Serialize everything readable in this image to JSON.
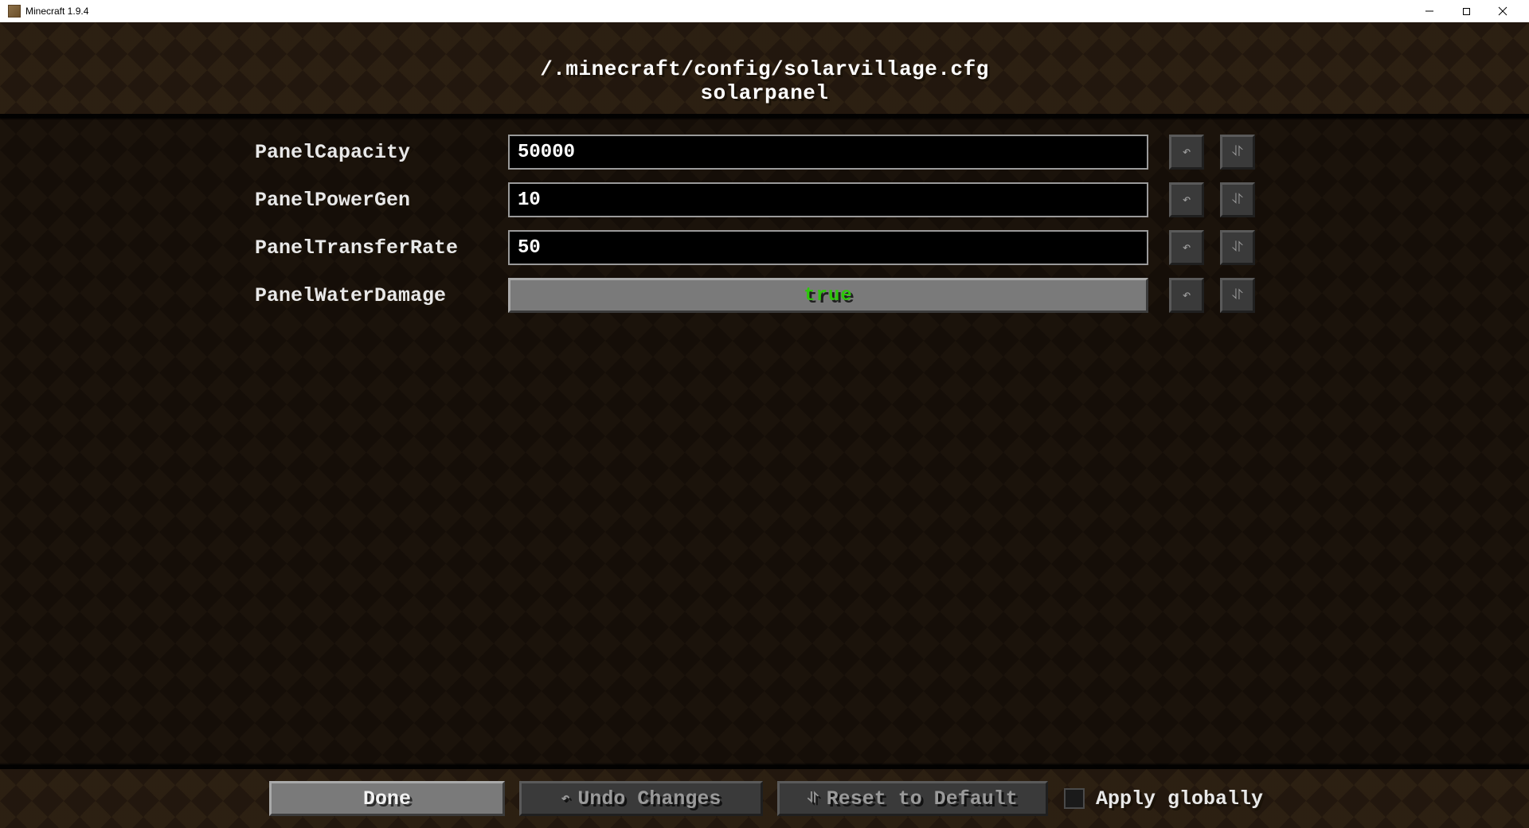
{
  "window": {
    "title": "Minecraft 1.9.4"
  },
  "header": {
    "path": "/.minecraft/config/solarvillage.cfg",
    "section": "solarpanel"
  },
  "config_rows": [
    {
      "key": "PanelCapacity",
      "type": "text",
      "value": "50000"
    },
    {
      "key": "PanelPowerGen",
      "type": "text",
      "value": "10"
    },
    {
      "key": "PanelTransferRate",
      "type": "text",
      "value": "50"
    },
    {
      "key": "PanelWaterDamage",
      "type": "toggle",
      "value": "true"
    }
  ],
  "icons": {
    "undo_glyph": "↶",
    "reset_glyph": "⥯"
  },
  "footer": {
    "done": "Done",
    "undo": "Undo Changes",
    "reset": "Reset to Default",
    "apply": "Apply globally",
    "apply_checked": false
  }
}
